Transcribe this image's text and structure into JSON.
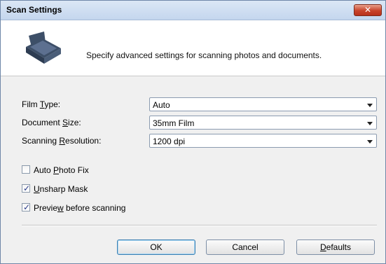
{
  "window": {
    "title": "Scan Settings",
    "close_label": "✕"
  },
  "header": {
    "text": "Specify advanced settings for scanning photos and documents."
  },
  "fields": [
    {
      "label_pre": "Film ",
      "label_access": "T",
      "label_post": "ype:",
      "value": "Auto"
    },
    {
      "label_pre": "Document ",
      "label_access": "S",
      "label_post": "ize:",
      "value": "35mm Film"
    },
    {
      "label_pre": "Scanning ",
      "label_access": "R",
      "label_post": "esolution:",
      "value": "1200 dpi"
    }
  ],
  "checkboxes": [
    {
      "label_pre": "Auto ",
      "label_access": "P",
      "label_post": "hoto Fix",
      "checked": false
    },
    {
      "label_pre": "",
      "label_access": "U",
      "label_post": "nsharp Mask",
      "checked": true
    },
    {
      "label_pre": "Previe",
      "label_access": "w",
      "label_post": " before scanning",
      "checked": true
    }
  ],
  "buttons": {
    "ok_label": "OK",
    "cancel_label": "Cancel",
    "defaults_pre": "",
    "defaults_access": "D",
    "defaults_post": "efaults"
  },
  "colors": {
    "titlebar": "#c4d6ee",
    "close": "#c8432a",
    "icon": "#3d4f68"
  },
  "check_mark": "✓"
}
